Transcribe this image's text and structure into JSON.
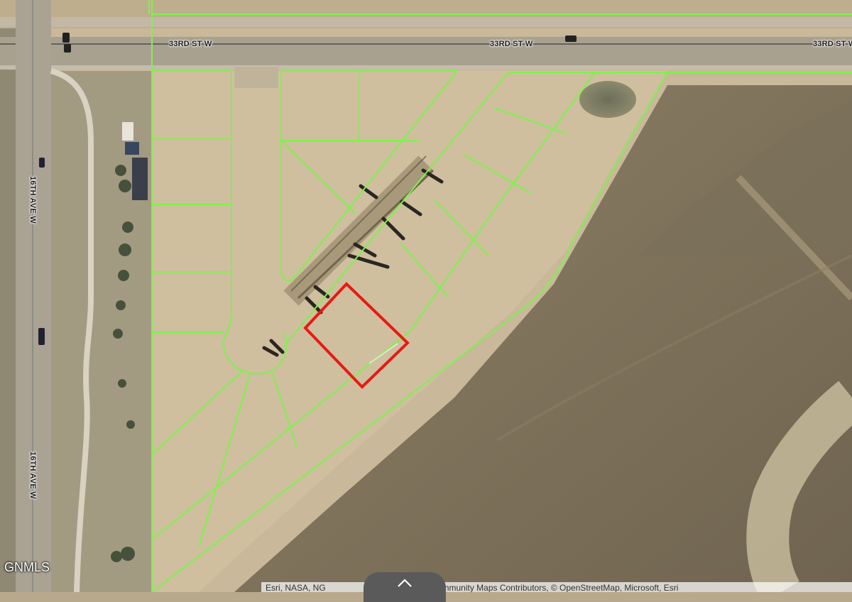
{
  "map": {
    "road_labels": {
      "street_north_1": "33RD ST W",
      "street_north_2": "33RD ST W",
      "street_north_3": "33RD ST W",
      "avenue_west_1": "16TH AVE W",
      "avenue_west_2": "16TH AVE W"
    },
    "colors": {
      "parcel_lines": "#7cf34a",
      "selected_parcel": "#e81a12",
      "imagery_base": "#b9a98c"
    }
  },
  "watermark": "GNMLS",
  "attribution": {
    "left": "Esri, NASA, NG",
    "right": "| Esri Community Maps Contributors, © OpenStreetMap, Microsoft, Esri"
  },
  "controls": {
    "collapse_icon": "chevron-up-icon"
  }
}
